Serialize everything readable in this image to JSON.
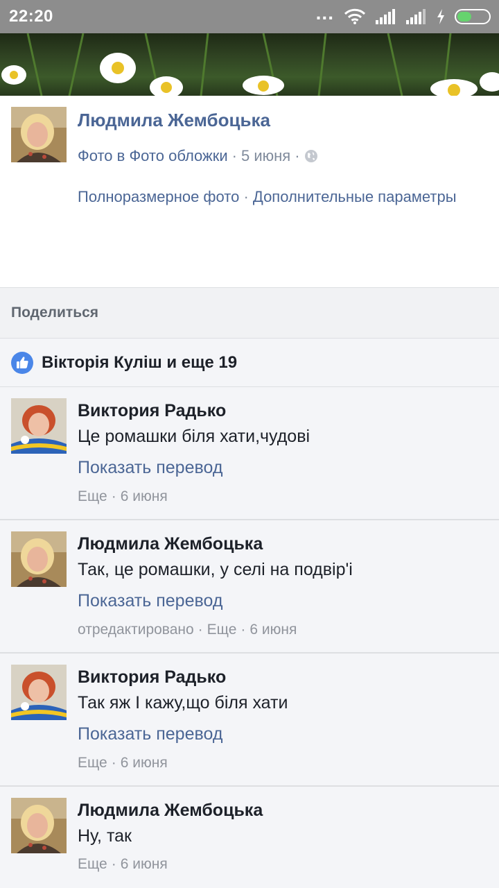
{
  "status_bar": {
    "time": "22:20",
    "dots": "..."
  },
  "post": {
    "author": "Людмила Жембоцька",
    "album_link": "Фото в Фото обложки",
    "sep": "·",
    "date": "5 июня",
    "full_size_link": "Полноразмерное фото",
    "more_options_link": "Дополнительные параметры"
  },
  "share": {
    "label": "Поделиться"
  },
  "likes": {
    "text": "Вікторія Куліш и еще 19"
  },
  "comments": [
    {
      "author": "Виктория Радько",
      "text": "Це ромашки біля хати,чудові",
      "translate": "Показать перевод",
      "edited": "",
      "more": "Еще",
      "date": "6 июня"
    },
    {
      "author": "Людмила Жембоцька",
      "text": "Так, це ромашки, у селі на подвір'і",
      "translate": "Показать перевод",
      "edited": "отредактировано",
      "more": "Еще",
      "date": "6 июня"
    },
    {
      "author": "Виктория Радько",
      "text": "Так яж І кажу,що біля хати",
      "translate": "Показать перевод",
      "edited": "",
      "more": "Еще",
      "date": "6 июня"
    },
    {
      "author": "Людмила Жембоцька",
      "text": "Ну, так",
      "translate": "",
      "edited": "",
      "more": "Еще",
      "date": "6 июня"
    }
  ],
  "colors": {
    "link": "#4b6695",
    "status_bar": "#8d8d8d",
    "like_blue": "#4a86e8",
    "battery": "#66d36e"
  }
}
